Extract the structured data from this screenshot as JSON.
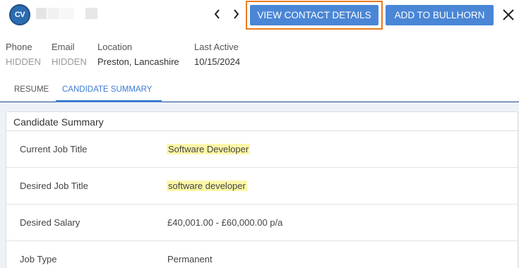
{
  "header": {
    "logo_text": "CV",
    "view_contact_label": "VIEW CONTACT DETAILS",
    "add_bullhorn_label": "ADD TO BULLHORN"
  },
  "info": {
    "phone_label": "Phone",
    "phone_value": "HIDDEN",
    "email_label": "Email",
    "email_value": "HIDDEN",
    "location_label": "Location",
    "location_value": "Preston, Lancashire",
    "last_active_label": "Last Active",
    "last_active_value": "10/15/2024"
  },
  "tabs": [
    {
      "label": "RESUME",
      "active": false
    },
    {
      "label": "CANDIDATE SUMMARY",
      "active": true
    }
  ],
  "summary": {
    "title": "Candidate Summary",
    "rows": [
      {
        "label": "Current Job Title",
        "value": "Software Developer",
        "highlighted": true
      },
      {
        "label": "Desired Job Title",
        "value": "software developer",
        "highlighted": true
      },
      {
        "label": "Desired Salary",
        "value": "£40,001.00 - £60,000.00 p/a",
        "highlighted": false
      },
      {
        "label": "Job Type",
        "value": "Permanent",
        "highlighted": false
      }
    ]
  },
  "colors": {
    "button_bg": "#4a86d6",
    "highlight_border": "#ea7a1e",
    "tab_active": "#3b7bd0",
    "text_highlight": "#fdf7a8"
  },
  "icons": [
    "cv-logo-icon",
    "chevron-left-icon",
    "chevron-right-icon",
    "close-icon"
  ]
}
